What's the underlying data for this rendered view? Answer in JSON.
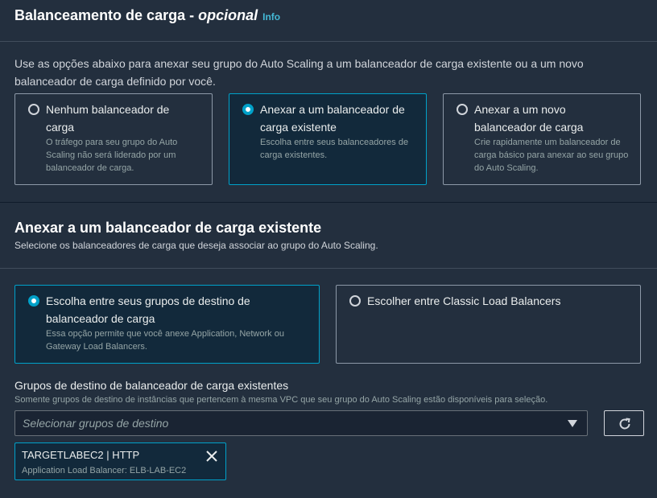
{
  "section1": {
    "title_main": "Balanceamento de carga - ",
    "title_italic": "opcional",
    "info_link": "Info",
    "description": "Use as opções abaixo para anexar seu grupo do Auto Scaling a um balanceador de carga existente ou a um novo balanceador de carga definido por você.",
    "options": [
      {
        "title": "Nenhum balanceador de carga",
        "desc": "O tráfego para seu grupo do Auto Scaling não será liderado por um balanceador de carga.",
        "selected": false
      },
      {
        "title": "Anexar a um balanceador de carga existente",
        "desc": "Escolha entre seus balanceadores de carga existentes.",
        "selected": true
      },
      {
        "title": "Anexar a um novo balanceador de carga",
        "desc": "Crie rapidamente um balanceador de carga básico para anexar ao seu grupo do Auto Scaling.",
        "selected": false
      }
    ]
  },
  "section2": {
    "title": "Anexar a um balanceador de carga existente",
    "subtitle": "Selecione os balanceadores de carga que deseja associar ao grupo do Auto Scaling.",
    "options": [
      {
        "title": "Escolha entre seus grupos de destino de balanceador de carga",
        "desc": "Essa opção permite que você anexe Application, Network ou Gateway Load Balancers.",
        "selected": true
      },
      {
        "title": "Escolher entre Classic Load Balancers",
        "desc": "",
        "selected": false
      }
    ],
    "field_label": "Grupos de destino de balanceador de carga existentes",
    "field_desc": "Somente grupos de destino de instâncias que pertencem à mesma VPC que seu grupo do Auto Scaling estão disponíveis para seleção.",
    "select_placeholder": "Selecionar grupos de destino",
    "token": {
      "title": "TARGETLABEC2 | HTTP",
      "subtitle": "Application Load Balancer: ELB-LAB-EC2"
    }
  },
  "colors": {
    "accent": "#00a1c9",
    "info": "#44b9d6",
    "panel": "#232f3e"
  },
  "icons": {
    "refresh": "refresh-icon",
    "close": "close-icon",
    "caret": "caret-down-icon"
  }
}
